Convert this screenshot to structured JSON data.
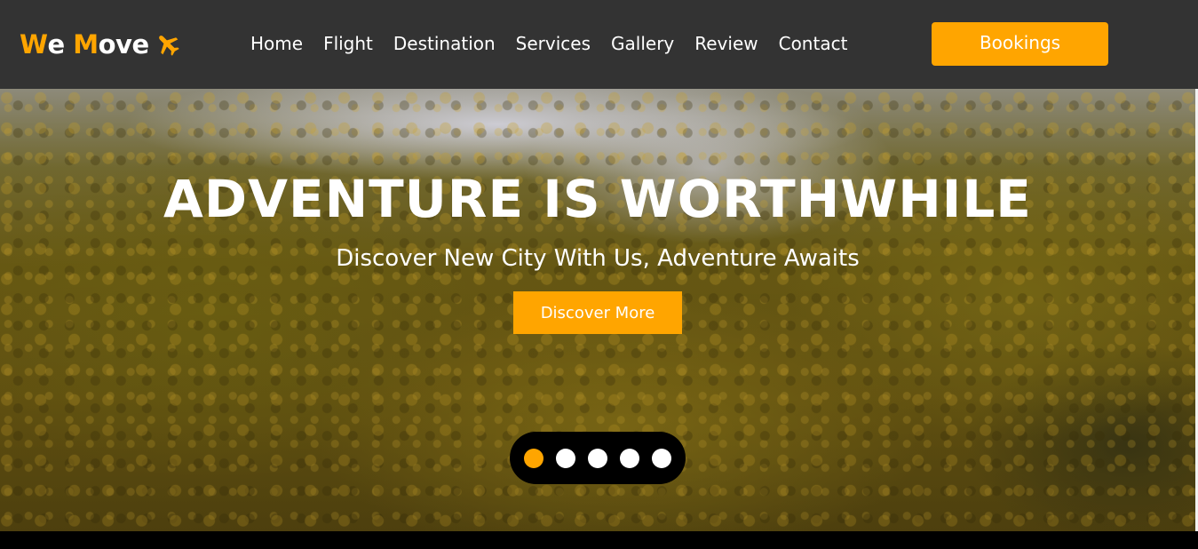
{
  "header": {
    "logo": {
      "part1_accent": "W",
      "part1_rest": "e ",
      "part2_accent": "M",
      "part2_rest": "ove",
      "icon": "plane-icon"
    },
    "nav": [
      {
        "label": "Home"
      },
      {
        "label": "Flight"
      },
      {
        "label": "Destination"
      },
      {
        "label": "Services"
      },
      {
        "label": "Gallery"
      },
      {
        "label": "Review"
      },
      {
        "label": "Contact"
      }
    ],
    "bookings_label": "Bookings"
  },
  "hero": {
    "title": "ADVENTURE IS WORTHWHILE",
    "subtitle": "Discover New City With Us, Adventure Awaits",
    "cta_label": "Discover More",
    "slides_total": 5,
    "active_slide": 1
  },
  "colors": {
    "accent": "#FFA500",
    "navbar_bg": "#333333",
    "text": "#FFFFFF"
  }
}
